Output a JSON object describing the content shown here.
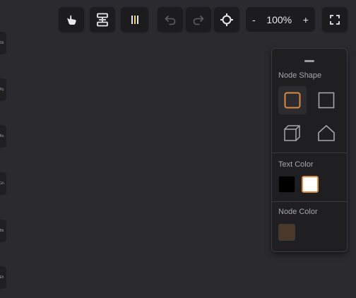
{
  "side_tabs": [
    "Sb",
    "Ry",
    "Bo",
    "Gh",
    "Bb",
    "Eh"
  ],
  "toolbar": {
    "zoom": {
      "minus": "-",
      "value": "100%",
      "plus": "+"
    }
  },
  "panel": {
    "node_shape_label": "Node Shape",
    "shapes": [
      "rounded-square",
      "square",
      "cube",
      "pentagon"
    ],
    "selected_shape": "rounded-square",
    "text_color_label": "Text Color",
    "text_colors": [
      "#000000",
      "#ffffff"
    ],
    "selected_text_color": "#ffffff",
    "node_color_label": "Node Color",
    "node_colors": [
      "#4a3828"
    ],
    "accent": "#d98a45"
  }
}
